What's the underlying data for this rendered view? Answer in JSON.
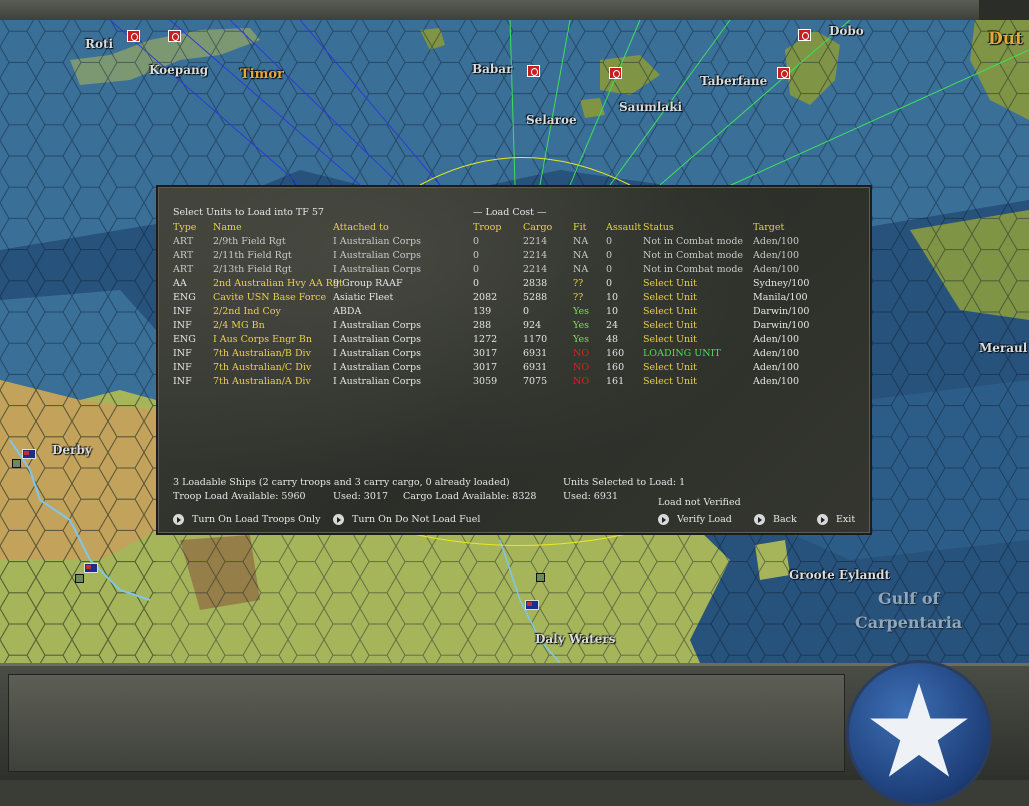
{
  "map": {
    "labels": [
      {
        "id": "roti",
        "text": "Roti"
      },
      {
        "id": "koepang",
        "text": "Koepang"
      },
      {
        "id": "timor",
        "text": "Timor"
      },
      {
        "id": "babar",
        "text": "Babar"
      },
      {
        "id": "selaroe",
        "text": "Selaroe"
      },
      {
        "id": "saumlaki",
        "text": "Saumlaki"
      },
      {
        "id": "taberfane",
        "text": "Taberfane"
      },
      {
        "id": "dobo",
        "text": "Dobo"
      },
      {
        "id": "dut",
        "text": "Dut"
      },
      {
        "id": "derby",
        "text": "Derby"
      },
      {
        "id": "meraul",
        "text": "Meraul"
      },
      {
        "id": "groote",
        "text": "Groote Eylandt"
      },
      {
        "id": "gulf",
        "text": "Gulf of"
      },
      {
        "id": "carpentaria",
        "text": "Carpentaria"
      },
      {
        "id": "daly",
        "text": "Daly Waters"
      }
    ],
    "colors": {
      "sea": "#26527c",
      "shallow": "#3a6f98",
      "land": "#a6b45a",
      "enemy": "#c61f1f"
    }
  },
  "dialog": {
    "title": "Select Units to Load into TF 57",
    "load_cost_header": "— Load Cost —",
    "columns": {
      "type": "Type",
      "name": "Name",
      "attached": "Attached to",
      "troop": "Troop",
      "cargo": "Cargo",
      "fit": "Fit",
      "assault": "Assault",
      "status": "Status",
      "target": "Target"
    },
    "rows": [
      {
        "type": "ART",
        "name": "2/9th Field Rgt",
        "attached": "I Australian Corps",
        "troop": "0",
        "cargo": "2214",
        "fit": "NA",
        "assault": "0",
        "status": "Not in Combat mode",
        "target": "Aden/100",
        "style": "grey"
      },
      {
        "type": "ART",
        "name": "2/11th Field Rgt",
        "attached": "I Australian Corps",
        "troop": "0",
        "cargo": "2214",
        "fit": "NA",
        "assault": "0",
        "status": "Not in Combat mode",
        "target": "Aden/100",
        "style": "grey"
      },
      {
        "type": "ART",
        "name": "2/13th Field Rgt",
        "attached": "I Australian Corps",
        "troop": "0",
        "cargo": "2214",
        "fit": "NA",
        "assault": "0",
        "status": "Not in Combat mode",
        "target": "Aden/100",
        "style": "grey"
      },
      {
        "type": "AA",
        "name": "2nd Australian Hvy AA Rgt",
        "attached": "9 Group RAAF",
        "troop": "0",
        "cargo": "2838",
        "fit": "??",
        "assault": "0",
        "status": "Select Unit",
        "target": "Sydney/100",
        "style": "q"
      },
      {
        "type": "ENG",
        "name": "Cavite USN Base Force",
        "attached": "Asiatic Fleet",
        "troop": "2082",
        "cargo": "5288",
        "fit": "??",
        "assault": "10",
        "status": "Select Unit",
        "target": "Manila/100",
        "style": "q"
      },
      {
        "type": "INF",
        "name": "2/2nd Ind Coy",
        "attached": "ABDA",
        "troop": "139",
        "cargo": "0",
        "fit": "Yes",
        "assault": "10",
        "status": "Select Unit",
        "target": "Darwin/100",
        "style": "yes"
      },
      {
        "type": "INF",
        "name": "2/4 MG Bn",
        "attached": "I Australian Corps",
        "troop": "288",
        "cargo": "924",
        "fit": "Yes",
        "assault": "24",
        "status": "Select Unit",
        "target": "Darwin/100",
        "style": "yes"
      },
      {
        "type": "ENG",
        "name": "I Aus Corps Engr Bn",
        "attached": "I Australian Corps",
        "troop": "1272",
        "cargo": "1170",
        "fit": "Yes",
        "assault": "48",
        "status": "Select Unit",
        "target": "Aden/100",
        "style": "yes"
      },
      {
        "type": "INF",
        "name": "7th Australian/B Div",
        "attached": "I Australian Corps",
        "troop": "3017",
        "cargo": "6931",
        "fit": "NO",
        "assault": "160",
        "status": "LOADING UNIT",
        "target": "Aden/100",
        "style": "loading"
      },
      {
        "type": "INF",
        "name": "7th Australian/C Div",
        "attached": "I Australian Corps",
        "troop": "3017",
        "cargo": "6931",
        "fit": "NO",
        "assault": "160",
        "status": "Select Unit",
        "target": "Aden/100",
        "style": "no"
      },
      {
        "type": "INF",
        "name": "7th Australian/A Div",
        "attached": "I Australian Corps",
        "troop": "3059",
        "cargo": "7075",
        "fit": "NO",
        "assault": "161",
        "status": "Select Unit",
        "target": "Aden/100",
        "style": "no"
      }
    ],
    "footer": {
      "ships": "3 Loadable Ships (2 carry troops and 3 carry cargo, 0 already loaded)",
      "troop_avail": "Troop Load Available: 5960",
      "troop_used": "Used: 3017",
      "cargo_avail": "Cargo Load Available: 8328",
      "cargo_used": "Used: 6931",
      "units_selected": "Units Selected to Load: 1",
      "load_status": "Load not Verified"
    },
    "buttons": {
      "troops_only": "Turn On Load Troops Only",
      "no_fuel": "Turn On Do Not Load Fuel",
      "verify": "Verify Load",
      "back": "Back",
      "exit": "Exit"
    }
  }
}
